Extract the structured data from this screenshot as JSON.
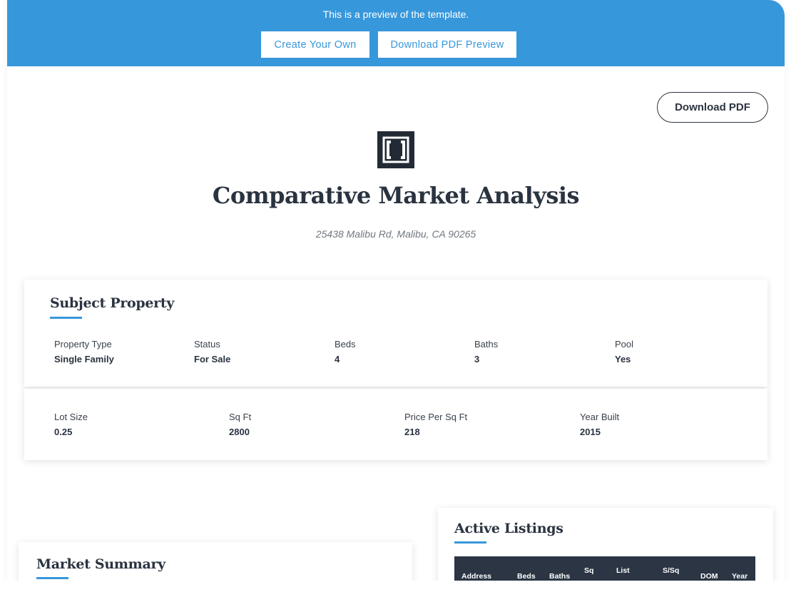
{
  "banner": {
    "message": "This is a preview of the template.",
    "create_label": "Create Your Own",
    "preview_label": "Download PDF Preview"
  },
  "toolbar": {
    "download_label": "Download PDF"
  },
  "report": {
    "title": "Comparative Market Analysis",
    "address": "25438 Malibu Rd, Malibu, CA 90265"
  },
  "subject_property": {
    "title": "Subject Property",
    "row1": [
      {
        "label": "Property Type",
        "value": "Single Family"
      },
      {
        "label": "Status",
        "value": "For Sale"
      },
      {
        "label": "Beds",
        "value": "4"
      },
      {
        "label": "Baths",
        "value": "3"
      },
      {
        "label": "Pool",
        "value": "Yes"
      }
    ],
    "row2": [
      {
        "label": "Lot Size",
        "value": "0.25"
      },
      {
        "label": "Sq Ft",
        "value": "2800"
      },
      {
        "label": "Price Per Sq Ft",
        "value": "218"
      },
      {
        "label": "Year Built",
        "value": "2015"
      }
    ]
  },
  "market_summary": {
    "title": "Market Summary"
  },
  "active_listings": {
    "title": "Active Listings",
    "columns": [
      "Address",
      "Beds",
      "Baths",
      "Sq",
      "List",
      "S/Sq",
      "DOM",
      "Year"
    ]
  },
  "colors": {
    "accent": "#3797db",
    "dark": "#2b3544"
  },
  "icons": {
    "logo": "bracket-logo-icon"
  }
}
